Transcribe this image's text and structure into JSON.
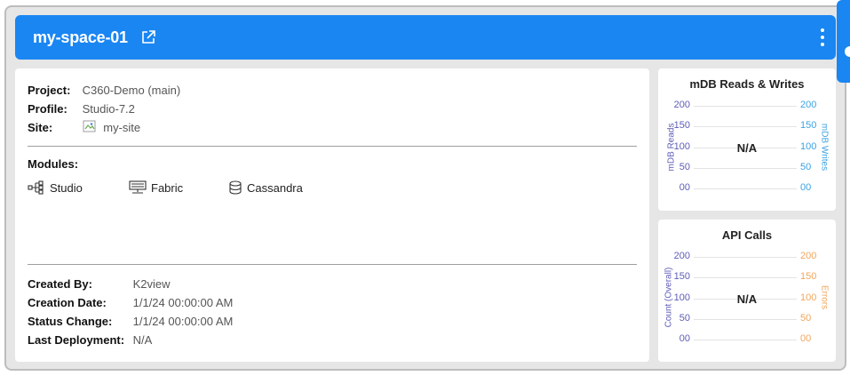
{
  "header": {
    "title": "my-space-01",
    "icons": [
      "external-link-icon",
      "more-vertical-icon"
    ]
  },
  "details": {
    "project_label": "Project:",
    "project_value": "C360-Demo (main)",
    "profile_label": "Profile:",
    "profile_value": "Studio-7.2",
    "site_label": "Site:",
    "site_value": "my-site"
  },
  "modules": {
    "label": "Modules:",
    "items": [
      {
        "name": "Studio",
        "icon": "network-icon"
      },
      {
        "name": "Fabric",
        "icon": "server-icon"
      },
      {
        "name": "Cassandra",
        "icon": "database-icon"
      }
    ]
  },
  "meta": {
    "created_by_label": "Created By:",
    "created_by_value": "K2view",
    "creation_date_label": "Creation Date:",
    "creation_date_value": "1/1/24 00:00:00 AM",
    "status_change_label": "Status Change:",
    "status_change_value": "1/1/24 00:00:00 AM",
    "last_deployment_label": "Last Deployment:",
    "last_deployment_value": "N/A"
  },
  "charts": {
    "reads_writes": {
      "title": "mDB Reads & Writes",
      "status": "N/A",
      "left_axis_label": "mDB Reads",
      "right_axis_label": "mDB Writes",
      "left_ticks": [
        "200",
        "150",
        "100",
        "50",
        "00"
      ],
      "right_ticks": [
        "200",
        "150",
        "100",
        "50",
        "00"
      ]
    },
    "api_calls": {
      "title": "API Calls",
      "status": "N/A",
      "left_axis_label": "Count (Overall)",
      "right_axis_label": "Errors",
      "left_ticks": [
        "200",
        "150",
        "100",
        "50",
        "00"
      ],
      "right_ticks": [
        "200",
        "150",
        "100",
        "50",
        "00"
      ]
    }
  },
  "colors": {
    "header_bg": "#1a86f2",
    "left_axis": "#5c5cb8",
    "right_axis_writes": "#3aa3e3",
    "right_axis_errors": "#f2a65a"
  }
}
